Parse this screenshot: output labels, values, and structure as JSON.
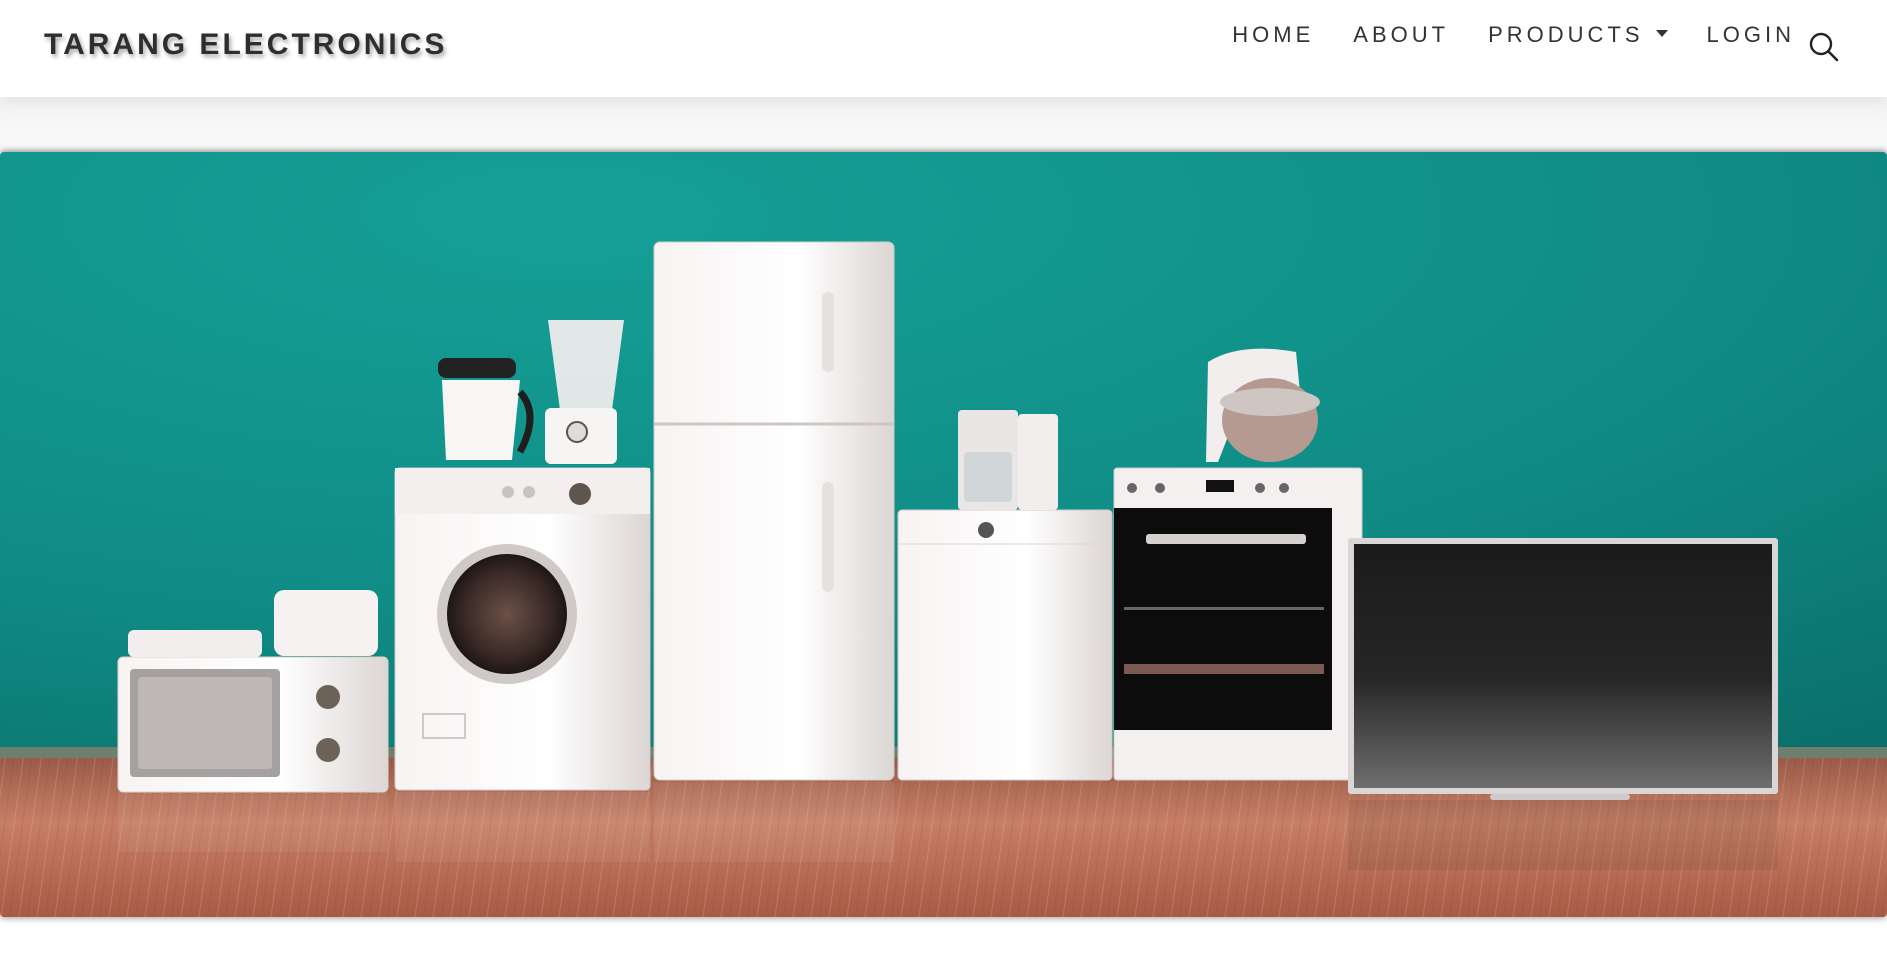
{
  "brand": {
    "name": "TARANG ELECTRONICS"
  },
  "nav": {
    "home": "HOME",
    "about": "ABOUT",
    "products": "PRODUCTS",
    "login": "LOGIN"
  },
  "icons": {
    "search": "search-icon",
    "dropdown": "caret-down-icon"
  },
  "hero": {
    "image": "home-appliances-banner"
  },
  "colors": {
    "wall": "#118f88",
    "floor": "#b96a52",
    "text": "#333333"
  }
}
